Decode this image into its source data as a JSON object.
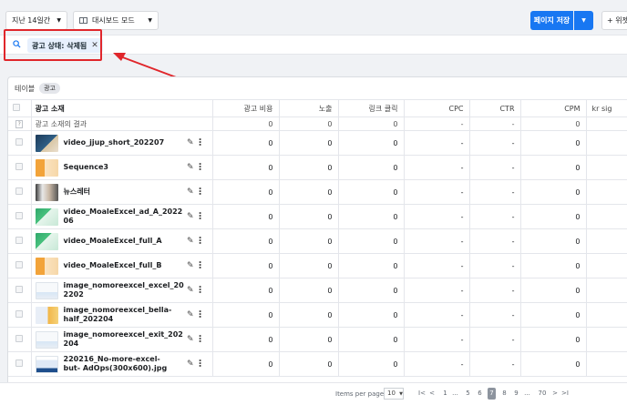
{
  "toolbar": {
    "date_range": "지난 14일간",
    "view_mode": "대시보드 모드",
    "save_label": "페이지 저장",
    "add_label": "+ 위젯"
  },
  "filter": {
    "chip_label": "광고 상태: 삭제됨"
  },
  "colors": {
    "accent": "#1877f2",
    "annotation": "#e0262b"
  },
  "table_section": {
    "title": "테이블",
    "tag": "광고"
  },
  "columns": [
    "광고 소재",
    "광고 비용",
    "노출",
    "링크 클릭",
    "CPC",
    "CTR",
    "CPM",
    "kr sig"
  ],
  "result_row": {
    "label": "광고 소재의 결과",
    "values": [
      "0",
      "0",
      "0",
      "-",
      "-",
      "0",
      ""
    ]
  },
  "rows": [
    {
      "name": "video_jjup_short_202207",
      "values": [
        "0",
        "0",
        "0",
        "-",
        "-",
        "0"
      ],
      "thumb": "video-dark"
    },
    {
      "name": "Sequence3",
      "values": [
        "0",
        "0",
        "0",
        "-",
        "-",
        "0"
      ],
      "thumb": "video-orange"
    },
    {
      "name": "뉴스레터",
      "values": [
        "0",
        "0",
        "0",
        "-",
        "-",
        "0"
      ],
      "thumb": "video-people"
    },
    {
      "name": "video_MoaleExcel_ad_A_2022 06",
      "values": [
        "0",
        "0",
        "0",
        "-",
        "-",
        "0"
      ],
      "thumb": "video-green"
    },
    {
      "name": "video_MoaleExcel_full_A",
      "values": [
        "0",
        "0",
        "0",
        "-",
        "-",
        "0"
      ],
      "thumb": "video-green"
    },
    {
      "name": "video_MoaleExcel_full_B",
      "values": [
        "0",
        "0",
        "0",
        "-",
        "-",
        "0"
      ],
      "thumb": "video-orange"
    },
    {
      "name": "image_nomoreexcel_excel_20 2202",
      "values": [
        "0",
        "0",
        "0",
        "-",
        "-",
        "0"
      ],
      "thumb": "image-doc"
    },
    {
      "name": "image_nomoreexcel_bella- half_202204",
      "values": [
        "0",
        "0",
        "0",
        "-",
        "-",
        "0"
      ],
      "thumb": "image-person"
    },
    {
      "name": "image_nomoreexcel_exit_202 204",
      "values": [
        "0",
        "0",
        "0",
        "-",
        "-",
        "0"
      ],
      "thumb": "image-doc"
    },
    {
      "name": "220216_No-more-excel-but- AdOps(300x600).jpg",
      "values": [
        "0",
        "0",
        "0",
        "-",
        "-",
        "0"
      ],
      "thumb": "image-tall"
    }
  ],
  "pagination": {
    "label": "Items per page",
    "per_page": "10",
    "first": "I<",
    "prev": "<",
    "pages": [
      "1",
      "...",
      "5",
      "6",
      "7",
      "8",
      "9",
      "...",
      "70"
    ],
    "current": "7",
    "next": ">",
    "last": ">I"
  }
}
